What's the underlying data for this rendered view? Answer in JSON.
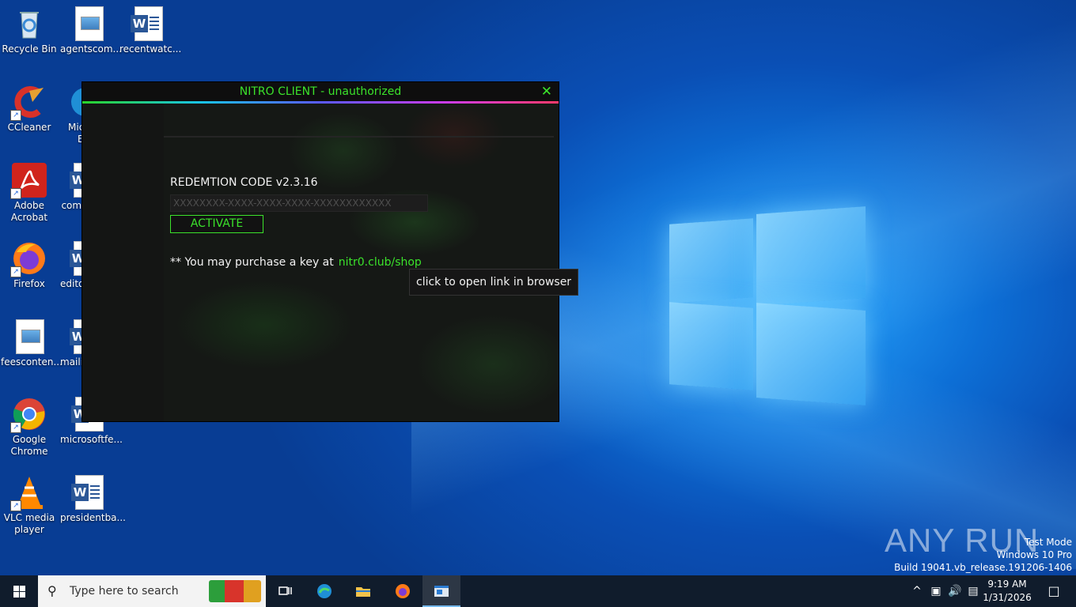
{
  "desktop": {
    "icons": [
      {
        "label": "Recycle Bin"
      },
      {
        "label": "agentscom..."
      },
      {
        "label": "recentwatc..."
      },
      {
        "label": "CCleaner"
      },
      {
        "label": "Mic..."
      },
      {
        "label": "E"
      },
      {
        "label": "Adobe Acrobat"
      },
      {
        "label": "com..."
      },
      {
        "label": "Firefox"
      },
      {
        "label": "edito..."
      },
      {
        "label": "feesconten..."
      },
      {
        "label": "maili..."
      },
      {
        "label": "Google Chrome"
      },
      {
        "label": "microsoftfe..."
      },
      {
        "label": "VLC media player"
      },
      {
        "label": "presidentba..."
      }
    ]
  },
  "app": {
    "title": "NITRO CLIENT - unauthorized",
    "close_glyph": "✕",
    "redemption_label": "REDEMTION CODE v2.3.16",
    "code_placeholder": "XXXXXXXX-XXXX-XXXX-XXXX-XXXXXXXXXXXX",
    "code_value": "",
    "activate_label": "ACTIVATE",
    "purchase_text": "** You may purchase a key at",
    "purchase_link": "nitr0.club/shop",
    "tooltip": "click to open link in browser",
    "colors": {
      "accent": "#3be22b",
      "background": "#151515"
    }
  },
  "watermark": {
    "brand": "ANY RUN",
    "lines": [
      "Test Mode",
      "Windows 10 Pro",
      "Build 19041.vb_release.191206-1406"
    ]
  },
  "taskbar": {
    "search_placeholder": "Type here to search",
    "search_icon": "search-icon",
    "pinned": [
      "task-view-icon",
      "edge-icon",
      "file-explorer-icon",
      "firefox-icon",
      "nitro-app-icon"
    ],
    "tray": {
      "chevron": "^",
      "time": "9:19 AM",
      "date": "1/31/2026"
    }
  }
}
